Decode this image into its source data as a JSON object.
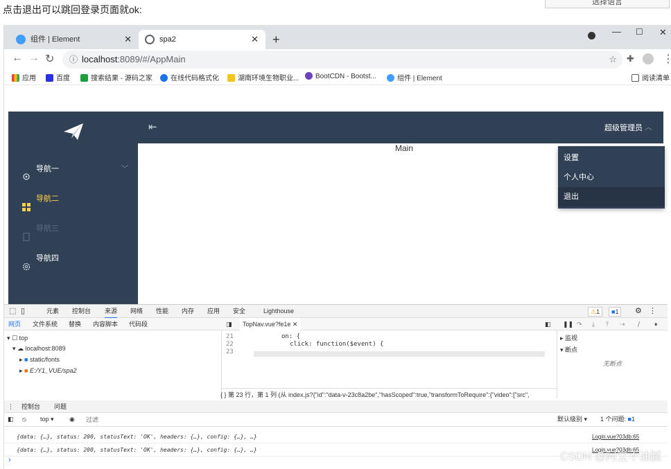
{
  "caption": "点击退出可以跳回登录页面就ok:",
  "lang_button": "选择语言",
  "browser": {
    "tabs": [
      {
        "title": "组件 | Element",
        "active": false
      },
      {
        "title": "spa2",
        "active": true
      }
    ],
    "url_host": "localhost",
    "url_rest": ":8089/#/AppMain",
    "bookmarks": [
      "应用",
      "百度",
      "搜索结果 - 源码之家",
      "在线代码格式化",
      "湖南环境生物职业...",
      "BootCDN - Bootst...",
      "组件 | Element"
    ],
    "reading_list": "阅读清单"
  },
  "app": {
    "user_name": "超级管理员",
    "main_title": "Main",
    "nav": [
      {
        "label": "导航一",
        "color": "#ffffff",
        "icon": "location-icon"
      },
      {
        "label": "导航二",
        "color": "#ffd04b",
        "icon": "menu-icon"
      },
      {
        "label": "导航三",
        "color": "#5b6b82",
        "icon": "document-icon"
      },
      {
        "label": "导航四",
        "color": "#ffffff",
        "icon": "setting-icon"
      }
    ],
    "dropdown": [
      "设置",
      "个人中心",
      "退出"
    ]
  },
  "devtools": {
    "tabs": [
      "元素",
      "控制台",
      "来源",
      "网络",
      "性能",
      "内存",
      "应用",
      "安全",
      "Lighthouse"
    ],
    "active_tab": "来源",
    "warn_count": "1",
    "msg_count": "1",
    "nav_tabs": [
      "网页",
      "文件系统",
      "替换",
      "内容脚本",
      "代码段"
    ],
    "file_tab": "TopNav.vue?fe1e",
    "tree": [
      "top",
      "localhost:8089",
      "static/fonts",
      "E:/Y1_VUE/spa2"
    ],
    "code_lines": [
      {
        "num": "21",
        "text": "on: {"
      },
      {
        "num": "22",
        "text": "click: function($event) {"
      },
      {
        "num": "23",
        "text": ""
      }
    ],
    "status_line": "第 23 行，第 1 列  (从 index.js?{\"id\":\"data-v-23c8a2be\",\"hasScoped\":true,\"transformToRequire\":{\"video\":[\"src\",",
    "right_panel": [
      "监视",
      "断点"
    ],
    "no_breakpoints": "无断点",
    "console_tabs": [
      "控制台",
      "问题"
    ],
    "context": "top",
    "filter_placeholder": "过滤",
    "level": "默认级别",
    "issues": "1 个问题:",
    "issues_count": "1",
    "logs": [
      {
        "text": "{data: {…}, status: 200, statusText: 'OK', headers: {…}, config: {…}, …}",
        "src": "Login.vue?03db:65"
      },
      {
        "text": "{data: {…}, status: 200, statusText: 'OK', headers: {…}, config: {…}, …}",
        "src": "Login.vue?03db:65"
      }
    ]
  },
  "watermark": "CSDN @阿立不油腻"
}
